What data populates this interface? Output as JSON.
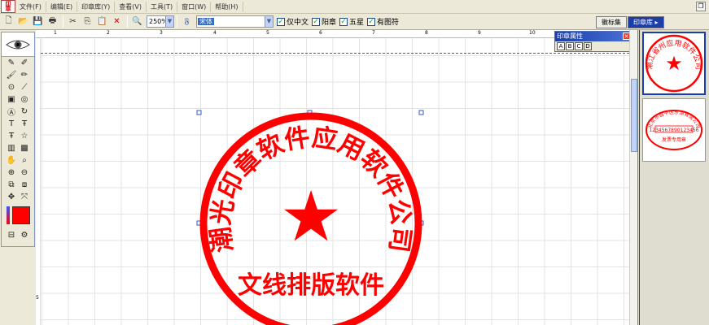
{
  "menubar": {
    "app_logo_text": "印章\n设计",
    "items": [
      "文件(F)",
      "编辑(E)",
      "印章库(Y)",
      "查看(V)",
      "工具(T)",
      "窗口(W)",
      "帮助(H)"
    ]
  },
  "toolbar": {
    "zoom_value": "250%",
    "font_value": "宋体",
    "checks": [
      {
        "label": "仅中文",
        "checked": true
      },
      {
        "label": "阳章",
        "checked": true
      },
      {
        "label": "五星",
        "checked": true
      },
      {
        "label": "有图符",
        "checked": true
      }
    ]
  },
  "right_tabs": {
    "logo_tab": "徽标集",
    "seal_tab": "印章库 ▸"
  },
  "properties_panel": {
    "title": "印章属性",
    "tabs": [
      "A",
      "B",
      "C",
      "D"
    ]
  },
  "ruler": {
    "top_labels": [
      "1",
      "2",
      "3",
      "4",
      "5",
      "6",
      "7",
      "8",
      "9",
      "10"
    ],
    "left_label": "5"
  },
  "seal": {
    "arc_text": "潮光印章软件应用软件公司",
    "bottom_text": "文线排版软件",
    "star": "★",
    "color": "#ff0000"
  },
  "gallery": {
    "thumb1_text": "潮江省州应用软件公司",
    "thumb2_arc": "北京市昌平区东湖有限公司",
    "thumb2_code": "1234567890123456",
    "thumb2_bottom": "发票专用章"
  },
  "colors": {
    "accent": "#1c3ea8",
    "seal_red": "#ff0000"
  }
}
